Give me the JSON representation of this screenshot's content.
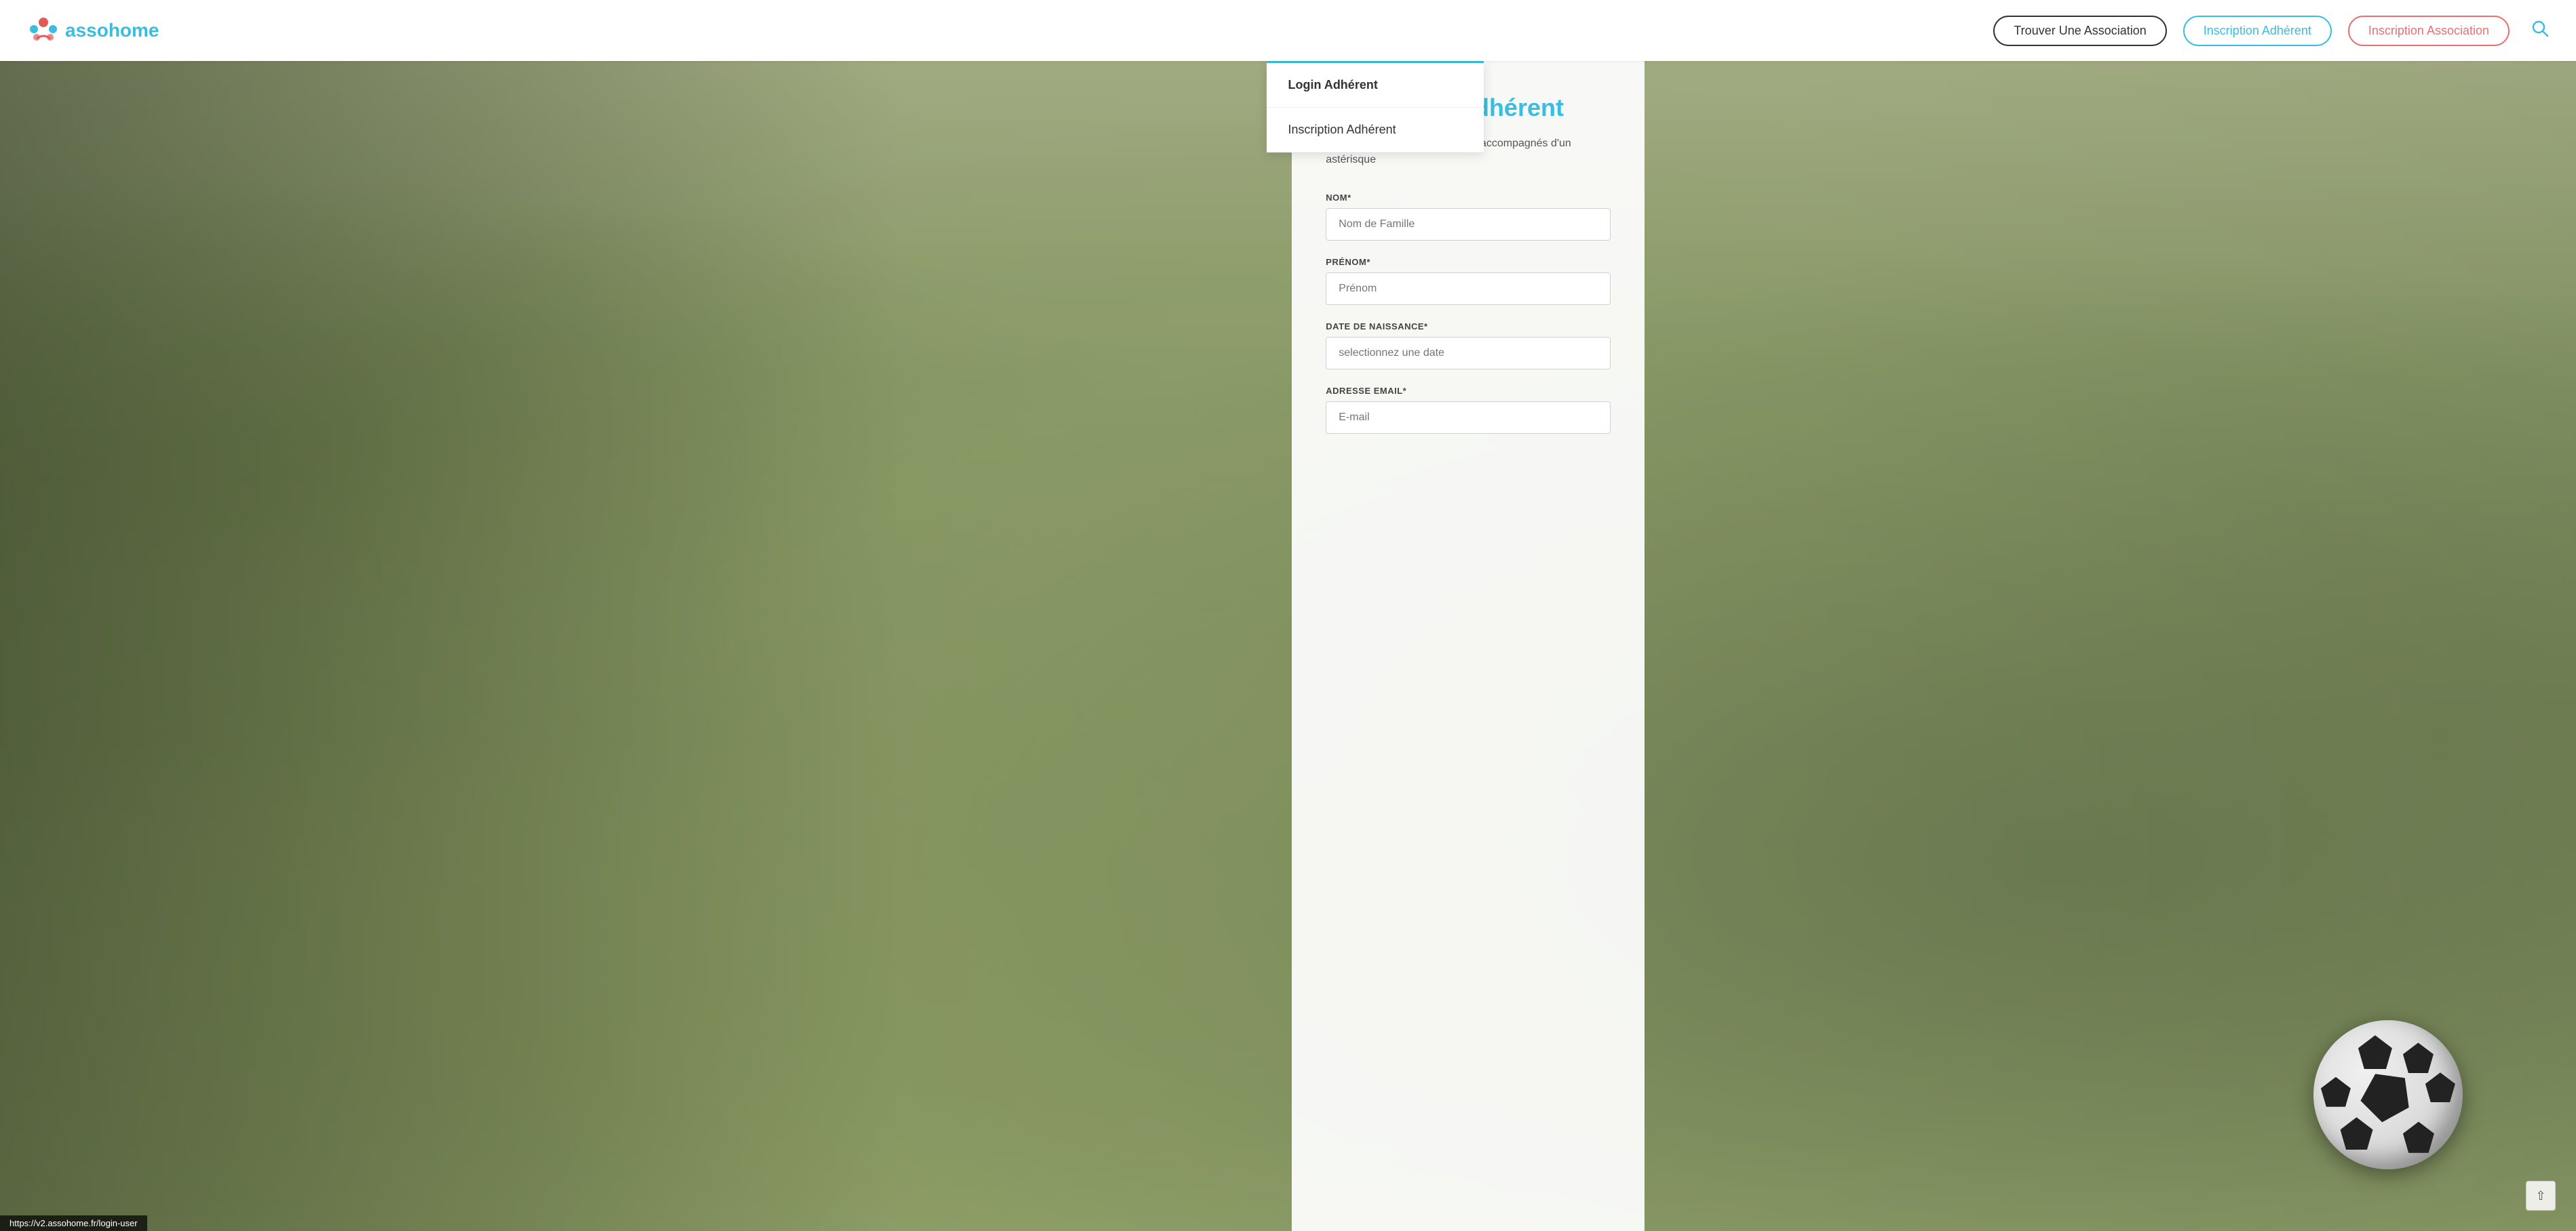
{
  "navbar": {
    "logo_text": "assohome",
    "btn_trouver": "Trouver Une Association",
    "btn_adherent": "Inscription Adhérent",
    "btn_association": "Inscription Association"
  },
  "dropdown": {
    "item1": "Login Adhérent",
    "item2": "Inscription Adhérent"
  },
  "form": {
    "title": "Inscription Adhérent",
    "note": "(*) les champs obligatoires sont accompagnés d'un astérisque",
    "nom_label": "NOM*",
    "nom_placeholder": "Nom de Famille",
    "prenom_label": "PRÉNOM*",
    "prenom_placeholder": "Prénom",
    "dob_label": "DATE DE NAISSANCE*",
    "dob_placeholder": "selectionnez une date",
    "email_label": "ADRESSE EMAIL*",
    "email_placeholder": "E-mail"
  },
  "status_bar": {
    "url": "https://v2.assohome.fr/login-user"
  }
}
